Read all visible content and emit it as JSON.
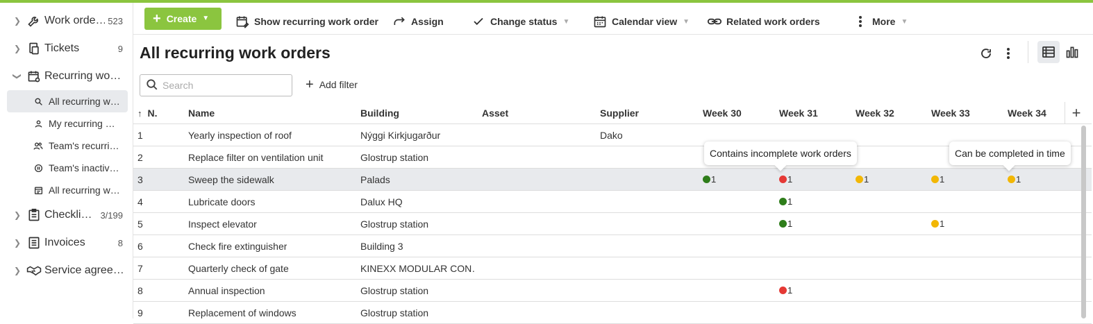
{
  "colors": {
    "accent": "#8bc53f",
    "green": "#2e7d1a",
    "red": "#e53935",
    "yellow": "#f2b705"
  },
  "sidebar": {
    "items": [
      {
        "label": "Work orde…",
        "count": "523",
        "icon": "wrench-icon",
        "expanded": false
      },
      {
        "label": "Tickets",
        "count": "9",
        "icon": "tickets-icon",
        "expanded": false
      },
      {
        "label": "Recurring wo…",
        "count": "",
        "icon": "recurring-calendar-icon",
        "expanded": true
      },
      {
        "label": "Checkli…",
        "count": "3/199",
        "icon": "checklist-icon",
        "expanded": false
      },
      {
        "label": "Invoices",
        "count": "8",
        "icon": "invoice-icon",
        "expanded": false
      },
      {
        "label": "Service agree…",
        "count": "",
        "icon": "handshake-icon",
        "expanded": false
      }
    ],
    "subitems": [
      {
        "label": "All recurring w…",
        "icon": "search-icon",
        "active": true
      },
      {
        "label": "My recurring …",
        "icon": "user-icon",
        "active": false
      },
      {
        "label": "Team's recurri…",
        "icon": "team-icon",
        "active": false
      },
      {
        "label": "Team's inactiv…",
        "icon": "pause-icon",
        "active": false
      },
      {
        "label": "All recurring w…",
        "icon": "calendar-list-icon",
        "active": false
      }
    ]
  },
  "toolbar": {
    "create": "Create",
    "show_recurring": "Show recurring work order",
    "assign": "Assign",
    "change_status": "Change status",
    "calendar_view": "Calendar view",
    "related": "Related work orders",
    "more": "More"
  },
  "page": {
    "title": "All recurring work orders",
    "search_placeholder": "Search",
    "add_filter": "Add filter"
  },
  "table": {
    "columns": [
      "N.",
      "Name",
      "Building",
      "Asset",
      "Supplier",
      "Week 30",
      "Week 31",
      "Week 32",
      "Week 33",
      "Week 34"
    ],
    "rows": [
      {
        "n": "1",
        "name": "Yearly inspection of roof",
        "building": "Nýggi Kirkjugarður",
        "asset": "",
        "supplier": "Dako",
        "weeks": [
          null,
          null,
          null,
          null,
          null
        ]
      },
      {
        "n": "2",
        "name": "Replace filter on ventilation unit",
        "building": "Glostrup station",
        "asset": "",
        "supplier": "",
        "weeks": [
          null,
          null,
          null,
          null,
          null
        ]
      },
      {
        "n": "3",
        "name": "Sweep the sidewalk",
        "building": "Palads",
        "asset": "",
        "supplier": "",
        "highlight": true,
        "weeks": [
          {
            "color": "green",
            "count": "1"
          },
          {
            "color": "red",
            "count": "1"
          },
          {
            "color": "yellow",
            "count": "1"
          },
          {
            "color": "yellow",
            "count": "1"
          },
          {
            "color": "yellow",
            "count": "1"
          }
        ]
      },
      {
        "n": "4",
        "name": "Lubricate doors",
        "building": "Dalux HQ",
        "asset": "",
        "supplier": "",
        "weeks": [
          null,
          {
            "color": "green",
            "count": "1"
          },
          null,
          null,
          null
        ]
      },
      {
        "n": "5",
        "name": "Inspect elevator",
        "building": "Glostrup station",
        "asset": "",
        "supplier": "",
        "weeks": [
          null,
          {
            "color": "green",
            "count": "1"
          },
          null,
          {
            "color": "yellow",
            "count": "1"
          },
          null
        ]
      },
      {
        "n": "6",
        "name": "Check fire extinguisher",
        "building": "Building 3",
        "asset": "",
        "supplier": "",
        "weeks": [
          null,
          null,
          null,
          null,
          null
        ]
      },
      {
        "n": "7",
        "name": "Quarterly check of gate",
        "building": "KINEXX MODULAR CON…",
        "asset": "",
        "supplier": "",
        "weeks": [
          null,
          null,
          null,
          null,
          null
        ]
      },
      {
        "n": "8",
        "name": "Annual inspection",
        "building": "Glostrup station",
        "asset": "",
        "supplier": "",
        "weeks": [
          null,
          {
            "color": "red",
            "count": "1"
          },
          null,
          null,
          null
        ]
      },
      {
        "n": "9",
        "name": "Replacement of windows",
        "building": "Glostrup station",
        "asset": "",
        "supplier": "",
        "weeks": [
          null,
          null,
          null,
          null,
          null
        ]
      }
    ]
  },
  "tooltips": {
    "incomplete": "Contains incomplete work orders",
    "in_time": "Can be completed in time"
  }
}
